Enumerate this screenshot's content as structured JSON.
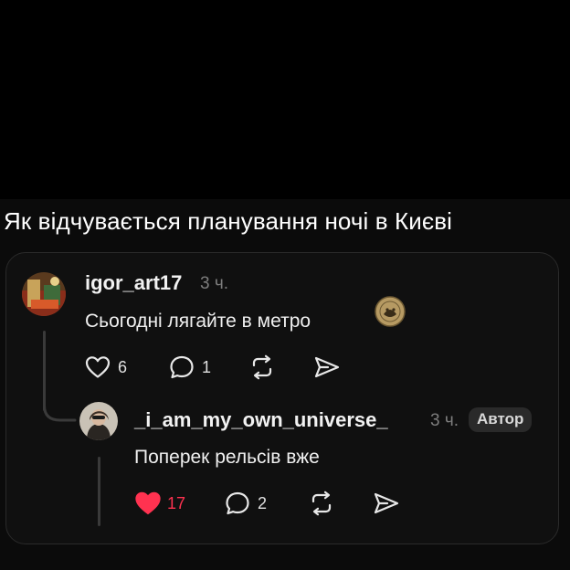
{
  "post": {
    "caption": "Як відчувається планування ночі в Києві"
  },
  "comment": {
    "username": "igor_art17",
    "time": "3 ч.",
    "text": "Сьогодні лягайте в метро",
    "likes": "6",
    "replies": "1"
  },
  "reply": {
    "username": "_i_am_my_own_universe_",
    "time": "3 ч.",
    "badge": "Автор",
    "text": "Поперек рельсів вже",
    "likes": "17",
    "replies": "2",
    "liked": true
  },
  "colors": {
    "background": "#0b0b0b",
    "text": "#f0f0f0",
    "muted": "#7d7d7d",
    "like_active": "#ff3250"
  },
  "icons": [
    "heart-icon",
    "comment-icon",
    "repost-icon",
    "share-icon",
    "sticker-icon"
  ]
}
